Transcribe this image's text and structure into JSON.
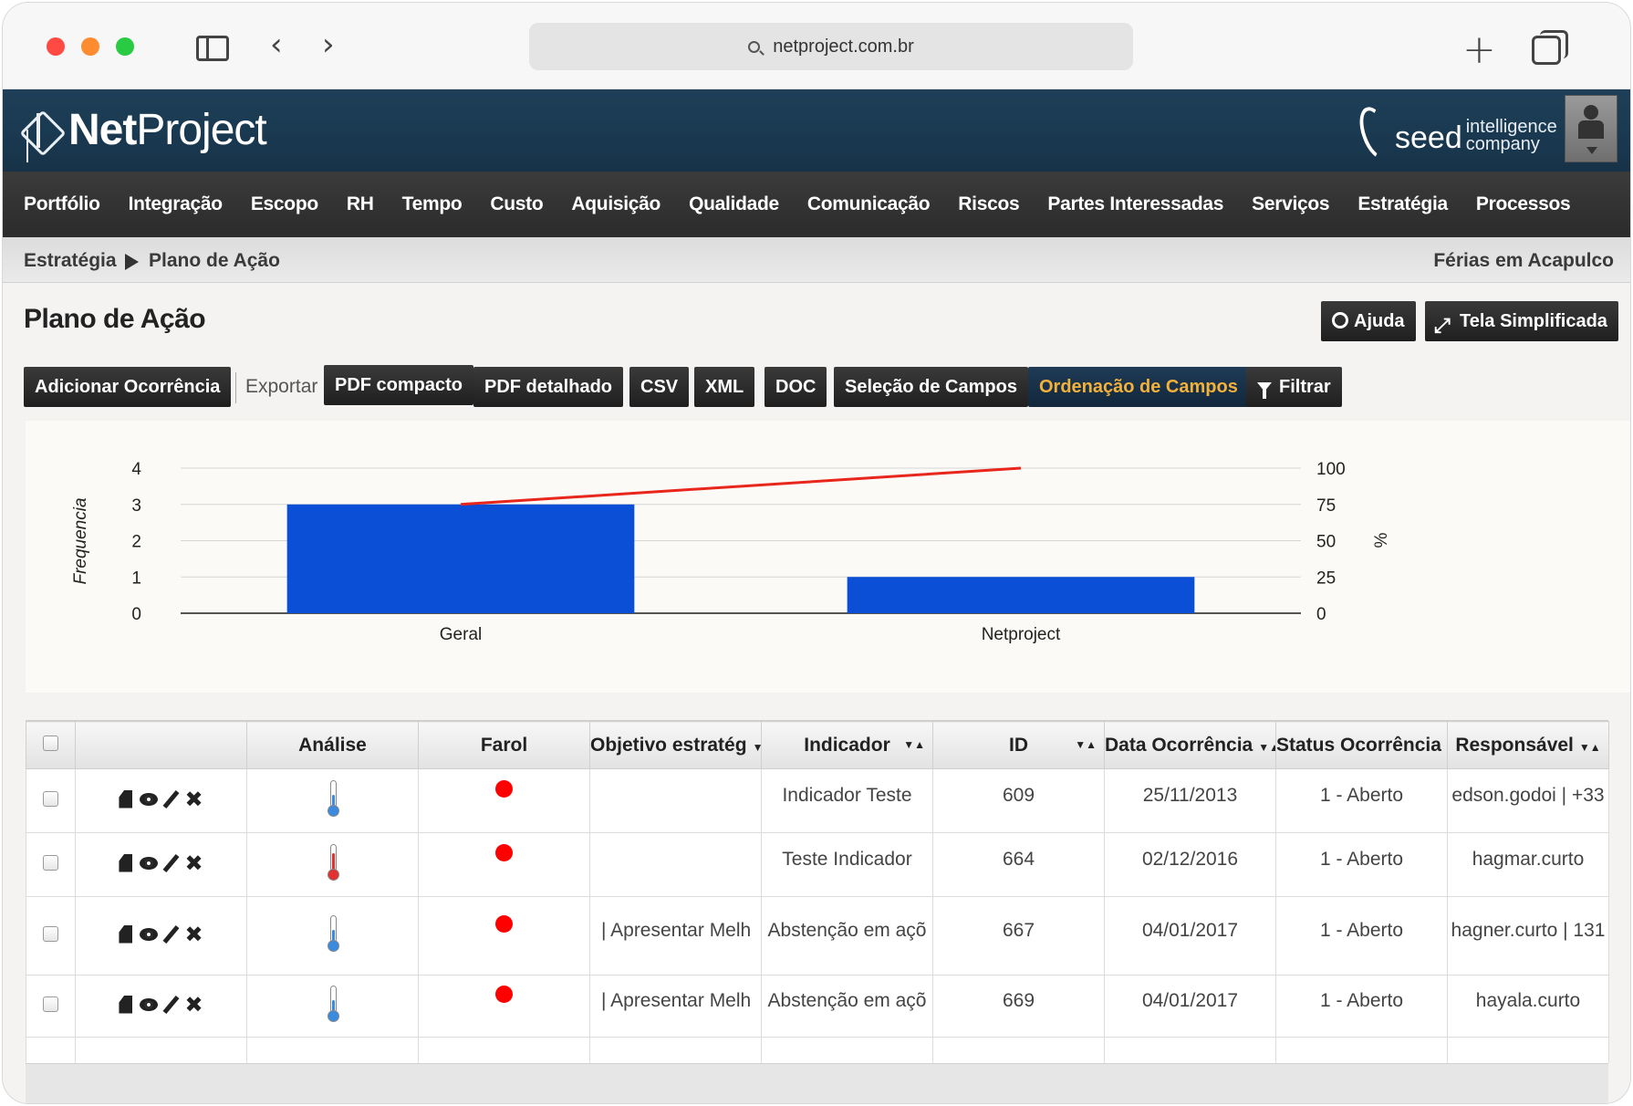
{
  "browser": {
    "url": "netproject.com.br"
  },
  "app": {
    "logo_bold": "Net",
    "logo_regular": "Project",
    "partner_name": "seed",
    "partner_tagline_1": "intelligence",
    "partner_tagline_2": "company"
  },
  "menu": {
    "items": [
      "Portfólio",
      "Integração",
      "Escopo",
      "RH",
      "Tempo",
      "Custo",
      "Aquisição",
      "Qualidade",
      "Comunicação",
      "Riscos",
      "Partes Interessadas",
      "Serviços",
      "Estratégia",
      "Processos"
    ]
  },
  "breadcrumb": {
    "parent": "Estratégia",
    "current": "Plano de Ação",
    "project": "Férias em Acapulco"
  },
  "page": {
    "title": "Plano de Ação",
    "help_label": "Ajuda",
    "simple_view_label": "Tela Simplificada"
  },
  "toolbar": {
    "add_label": "Adicionar Ocorrência",
    "export_label": "Exportar",
    "pdf_compact": "PDF compacto",
    "pdf_detailed": "PDF detalhado",
    "csv": "CSV",
    "xml": "XML",
    "doc": "DOC",
    "field_selection": "Seleção de Campos",
    "field_ordering": "Ordenação de Campos",
    "filter": "Filtrar"
  },
  "chart_data": {
    "type": "bar",
    "categories": [
      "Geral",
      "Netproject"
    ],
    "values": [
      3,
      1
    ],
    "line_values": [
      75,
      100
    ],
    "ylabel": "Frequencia",
    "y2label": "%",
    "ylim": [
      0,
      4
    ],
    "y2lim": [
      0,
      100
    ],
    "yticks": [
      "0",
      "1",
      "2",
      "3",
      "4"
    ],
    "y2ticks": [
      "0",
      "25",
      "50",
      "75",
      "100"
    ],
    "bar_color": "#0a4fd6",
    "line_color": "#e8261c",
    "grid": true
  },
  "table": {
    "headers": {
      "analise": "Análise",
      "farol": "Farol",
      "objetivo": "Objetivo estratég",
      "indicador": "Indicador",
      "id": "ID",
      "data": "Data Ocorrência",
      "status": "Status Ocorrência",
      "responsavel": "Responsável"
    },
    "rows": [
      {
        "thermo": "blue",
        "objetivo": "",
        "indicador": "Indicador Teste",
        "id": "609",
        "data": "25/11/2013",
        "status": "1 - Aberto",
        "responsavel": "edson.godoi | +33"
      },
      {
        "thermo": "red",
        "objetivo": "",
        "indicador": "Teste Indicador",
        "id": "664",
        "data": "02/12/2016",
        "status": "1 - Aberto",
        "responsavel": "hagmar.curto"
      },
      {
        "thermo": "blue",
        "objetivo": "| Apresentar Melh",
        "indicador": "Abstenção em açõ",
        "id": "667",
        "data": "04/01/2017",
        "status": "1 - Aberto",
        "responsavel": "hagner.curto | 131"
      },
      {
        "thermo": "blue",
        "objetivo": "| Apresentar Melh",
        "indicador": "Abstenção em açõ",
        "id": "669",
        "data": "04/01/2017",
        "status": "1 - Aberto",
        "responsavel": "hayala.curto"
      }
    ]
  }
}
